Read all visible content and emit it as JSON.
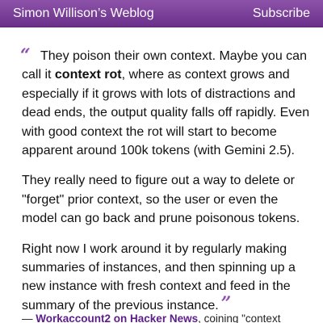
{
  "header": {
    "site_title": "Simon Willison’s Weblog",
    "subscribe_label": "Subscribe"
  },
  "quote": {
    "open_mark": "“",
    "close_mark": "”",
    "p1_line1": "They poison their own context. Maybe you can",
    "p1_line2_pre": "call it ",
    "p1_line2_bold": "context rot",
    "p1_line2_post": ", where as context grows and",
    "p1_line3": "especially if it grows with lots of distractions and",
    "p1_line4": "dead ends, the output quality falls off rapidly. Even",
    "p1_line5": "with good context the rot will start to become",
    "p1_line6": "apparent around 100k tokens (with Gemini 2.5).",
    "p2_line1": "They really need to figure out a way to delete or",
    "p2_line2": "\"forget\" prior context, so the user or even the",
    "p2_line3": "model can go back and prune poisonous tokens.",
    "p3_line1": "Right now I work around it by regularly making",
    "p3_line2": "summaries of instances, and then spinning up a",
    "p3_line3": "new instance with fresh context and feed in the",
    "p3_line4": "summary of the previous instance."
  },
  "attribution": {
    "dash": "— ",
    "link_text": "Workaccount2 on Hacker News",
    "suffix": ", coining \"context"
  },
  "colors": {
    "header_top": "#8d52a8",
    "header_bottom": "#6a2f89",
    "quote_mark": "#8e4eb0",
    "link": "#5c1d8b"
  }
}
